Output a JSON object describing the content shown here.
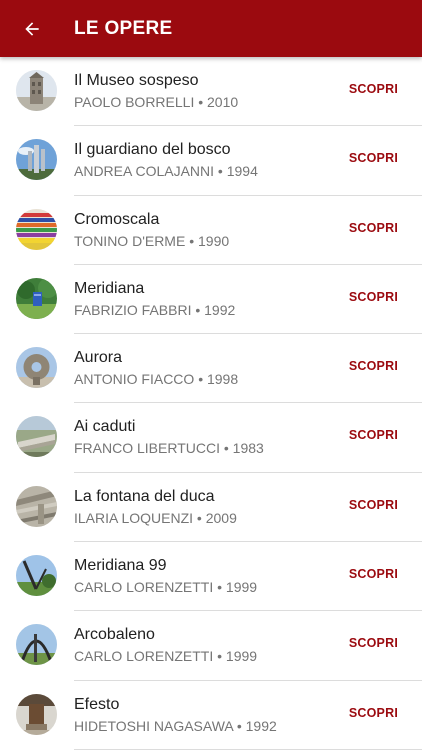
{
  "appbar": {
    "title": "LE OPERE",
    "back_icon": "arrow-back-icon",
    "color": "#9b0a0f"
  },
  "action_color": "#9b0a0f",
  "works": [
    {
      "title": "Il Museo sospeso",
      "subtitle": "PAOLO BORRELLI • 2010",
      "action": "SCOPRI",
      "thumb": "photo-tower-icon"
    },
    {
      "title": "Il guardiano del bosco",
      "subtitle": "ANDREA COLAJANNI • 1994",
      "action": "SCOPRI",
      "thumb": "photo-sculpture-sky-icon"
    },
    {
      "title": "Cromoscala",
      "subtitle": "TONINO D'ERME • 1990",
      "action": "SCOPRI",
      "thumb": "photo-color-stripes-icon"
    },
    {
      "title": "Meridiana",
      "subtitle": "FABRIZIO FABBRI • 1992",
      "action": "SCOPRI",
      "thumb": "photo-meridian-park-icon"
    },
    {
      "title": "Aurora",
      "subtitle": "ANTONIO FIACCO • 1998",
      "action": "SCOPRI",
      "thumb": "photo-stone-ring-icon"
    },
    {
      "title": "Ai caduti",
      "subtitle": "FRANCO LIBERTUCCI • 1983",
      "action": "SCOPRI",
      "thumb": "photo-monument-icon"
    },
    {
      "title": "La fontana del duca",
      "subtitle": "ILARIA LOQUENZI • 2009",
      "action": "SCOPRI",
      "thumb": "photo-fountain-icon"
    },
    {
      "title": "Meridiana 99",
      "subtitle": "CARLO LORENZETTI • 1999",
      "action": "SCOPRI",
      "thumb": "photo-meridian-99-icon"
    },
    {
      "title": "Arcobaleno",
      "subtitle": "CARLO LORENZETTI • 1999",
      "action": "SCOPRI",
      "thumb": "photo-arch-icon"
    },
    {
      "title": "Efesto",
      "subtitle": "HIDETOSHI NAGASAWA • 1992",
      "action": "SCOPRI",
      "thumb": "photo-efesto-icon"
    }
  ]
}
